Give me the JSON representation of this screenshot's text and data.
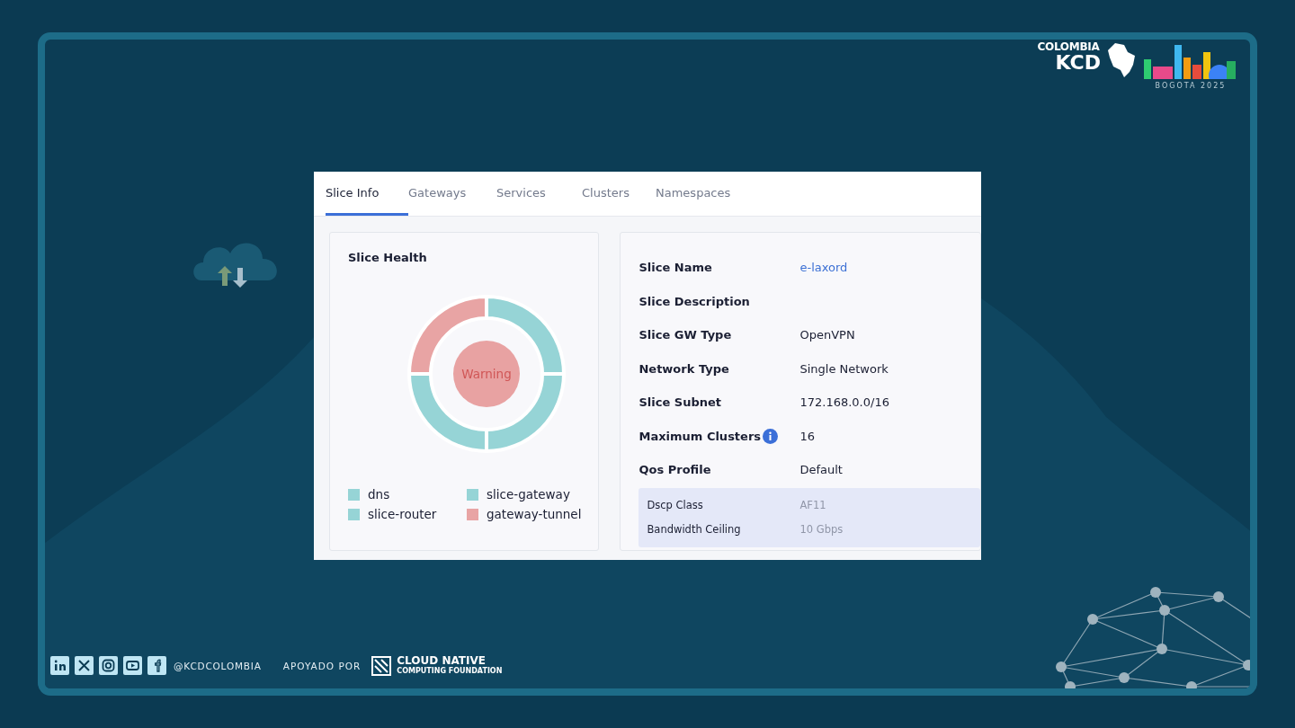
{
  "slide": {
    "logo": {
      "title": "COLOMBIA",
      "name": "KCD",
      "subtitle": "BOGOTA 2025"
    },
    "footer": {
      "handle": "@KCDCOLOMBIA",
      "supported_by": "APOYADO POR",
      "sponsor_line_1": "CLOUD NATIVE",
      "sponsor_line_2": "COMPUTING FOUNDATION"
    }
  },
  "screenshot": {
    "tabs": [
      {
        "label": "Slice Info",
        "selected": true
      },
      {
        "label": "Gateways",
        "selected": false
      },
      {
        "label": "Services",
        "selected": false
      },
      {
        "label": "Clusters",
        "selected": false
      },
      {
        "label": "Namespaces",
        "selected": false
      }
    ],
    "health": {
      "title": "Slice Health",
      "status": "Warning",
      "legend": [
        {
          "label": "dns",
          "color": "#96d4d6"
        },
        {
          "label": "slice-gateway",
          "color": "#96d4d6"
        },
        {
          "label": "slice-router",
          "color": "#96d4d6"
        },
        {
          "label": "gateway-tunnel",
          "color": "#e8a4a4"
        }
      ]
    },
    "details": [
      {
        "label": "Slice Name",
        "value": "e-laxord",
        "kind": "link"
      },
      {
        "label": "Slice Description",
        "kind": "text"
      },
      {
        "label": "Slice GW Type",
        "value": "OpenVPN",
        "kind": "text"
      },
      {
        "label": "Network Type",
        "value": "Single Network",
        "kind": "text"
      },
      {
        "label": "Slice Subnet",
        "value": "172.168.0.0/16",
        "kind": "text"
      },
      {
        "label": "Maximum Clusters",
        "value": "16",
        "kind": "info"
      },
      {
        "label": "Qos Profile",
        "value": "Default",
        "kind": "text"
      }
    ],
    "qos": [
      {
        "label": "Dscp Class",
        "value": "AF11"
      },
      {
        "label": "Bandwidth Ceiling",
        "value": "10 Gbps"
      }
    ]
  }
}
